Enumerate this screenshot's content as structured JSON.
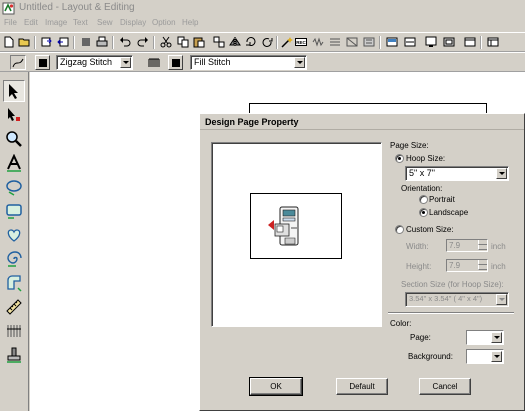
{
  "window": {
    "title": "Untitled - Layout & Editing"
  },
  "menu": [
    "File",
    "Edit",
    "Image",
    "Text",
    "Sew",
    "Display",
    "Option",
    "Help"
  ],
  "toolbar": {
    "row1_icons": [
      "new-file-icon",
      "open-folder-icon",
      "import-icon",
      "export-icon",
      "stop-icon",
      "print-icon",
      "undo-icon",
      "redo-icon",
      "cut-icon",
      "copy-icon",
      "paste-icon",
      "duplicate-icon",
      "mirror-icon",
      "flip-icon",
      "rotate-icon",
      "wand-icon",
      "rec-icon",
      "stitch-icon-1",
      "stitch-icon-2",
      "stitch-icon-3",
      "stitch-icon-4",
      "display-icon-1",
      "display-icon-2",
      "display-icon-3",
      "display-icon-4",
      "window-icon"
    ],
    "rec_label": "REC",
    "line_stitch": "Zigzag Stitch",
    "region_stitch": "Fill Stitch"
  },
  "tools": [
    "select-arrow-icon",
    "point-edit-icon",
    "zoom-icon",
    "text-icon",
    "circle-shape-icon",
    "rectangle-shape-icon",
    "heart-shape-icon",
    "spiral-icon",
    "outline-icon",
    "ruler-icon",
    "stitch-grid-icon",
    "stamp-icon"
  ],
  "dialog": {
    "title": "Design Page Property",
    "page_size_label": "Page Size:",
    "hoop_size_label": "Hoop Size:",
    "hoop_size_value": "5\" x 7\"",
    "orientation_label": "Orientation:",
    "portrait_label": "Portrait",
    "landscape_label": "Landscape",
    "custom_size_label": "Custom Size:",
    "width_label": "Width:",
    "width_value": "7.9",
    "height_label": "Height:",
    "height_value": "7.9",
    "unit": "inch",
    "section_size_label": "Section Size (for Hoop Size):",
    "section_size_value": "3.54\" x 3.54\" ( 4\" x 4\")",
    "color_label": "Color:",
    "page_color_label": "Page:",
    "background_color_label": "Background:",
    "ok_label": "OK",
    "default_label": "Default",
    "cancel_label": "Cancel",
    "selected_page_size": "Hoop Size",
    "selected_orientation": "Landscape"
  },
  "colors": {
    "chrome": "#d4d0c8",
    "canvas": "#ffffff",
    "hoop_arrow": "#cc2222",
    "machine_accent": "#4a8a9a"
  }
}
